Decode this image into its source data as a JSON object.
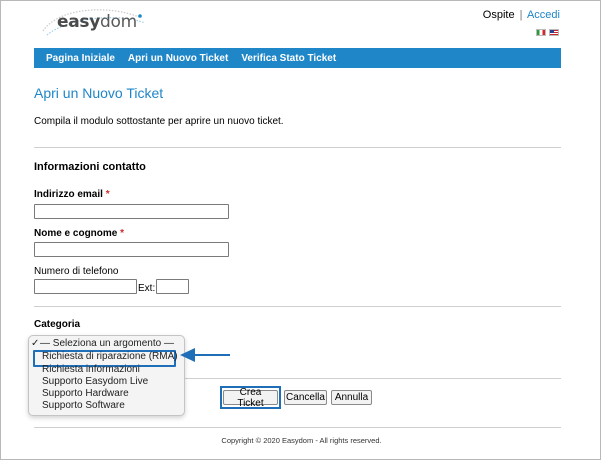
{
  "header": {
    "brand": {
      "name_part1": "easy",
      "name_part2": "dom"
    },
    "user": "Ospite",
    "separator": "|",
    "login_link": "Accedi",
    "flags": [
      {
        "icon": "flag-italy-icon"
      },
      {
        "icon": "flag-usa-icon"
      }
    ]
  },
  "nav": {
    "items": [
      {
        "label": "Pagina Iniziale"
      },
      {
        "label": "Apri un Nuovo Ticket"
      },
      {
        "label": "Verifica Stato Ticket"
      }
    ]
  },
  "main": {
    "title": "Apri un Nuovo Ticket",
    "intro": "Compila il modulo sottostante per aprire un nuovo ticket."
  },
  "contact": {
    "section_title": "Informazioni contatto",
    "email_label": "Indirizzo email",
    "name_label": "Nome e cognome",
    "required_mark": "*",
    "phone_label": "Numero di telefono",
    "ext_label": "Ext:",
    "email_value": "",
    "name_value": "",
    "phone_value": "",
    "ext_value": ""
  },
  "category": {
    "title": "Categoria",
    "checkmark": "✓",
    "options": [
      {
        "label": "— Seleziona un argomento —",
        "selected": true
      },
      {
        "label": "Richiesta di riparazione (RMA)",
        "highlighted": true
      },
      {
        "label": "Richiesta informazioni"
      },
      {
        "label": "Supporto Easydom Live"
      },
      {
        "label": "Supporto Hardware"
      },
      {
        "label": "Supporto Software"
      }
    ]
  },
  "buttons": {
    "create": "Crea Ticket",
    "reset": "Cancella",
    "cancel": "Annulla"
  },
  "footer": {
    "copyright": "Copyright © 2020 Easydom - All rights reserved."
  },
  "colors": {
    "accent": "#1f86c8",
    "highlight_box": "#1f6fb8",
    "required": "#d12a2a"
  }
}
